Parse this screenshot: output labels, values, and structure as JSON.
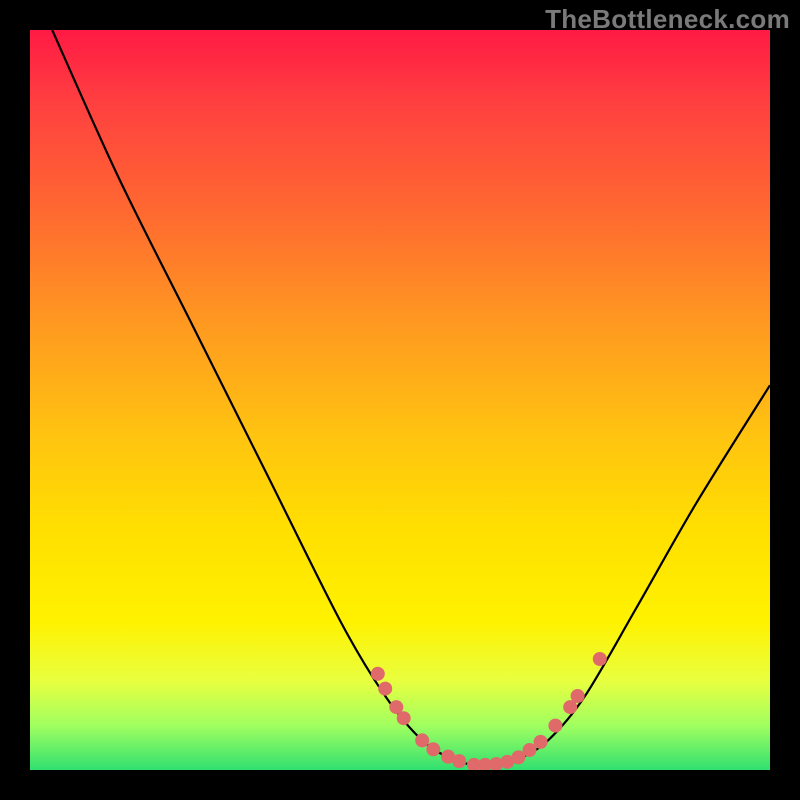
{
  "watermark": "TheBottleneck.com",
  "chart_data": {
    "type": "line",
    "title": "",
    "xlabel": "",
    "ylabel": "",
    "xlim": [
      0,
      100
    ],
    "ylim": [
      0,
      100
    ],
    "curve": [
      {
        "x": 3,
        "y": 100
      },
      {
        "x": 12,
        "y": 80
      },
      {
        "x": 22,
        "y": 60
      },
      {
        "x": 32,
        "y": 40
      },
      {
        "x": 42,
        "y": 20
      },
      {
        "x": 48,
        "y": 10
      },
      {
        "x": 53,
        "y": 4
      },
      {
        "x": 57,
        "y": 1.5
      },
      {
        "x": 60,
        "y": 0.7
      },
      {
        "x": 63,
        "y": 0.7
      },
      {
        "x": 66,
        "y": 1.5
      },
      {
        "x": 70,
        "y": 4
      },
      {
        "x": 75,
        "y": 10
      },
      {
        "x": 82,
        "y": 22
      },
      {
        "x": 90,
        "y": 36
      },
      {
        "x": 100,
        "y": 52
      }
    ],
    "dots": [
      {
        "x": 47,
        "y": 13
      },
      {
        "x": 48,
        "y": 11
      },
      {
        "x": 49.5,
        "y": 8.5
      },
      {
        "x": 50.5,
        "y": 7
      },
      {
        "x": 53,
        "y": 4
      },
      {
        "x": 54.5,
        "y": 2.8
      },
      {
        "x": 56.5,
        "y": 1.8
      },
      {
        "x": 58,
        "y": 1.2
      },
      {
        "x": 60,
        "y": 0.7
      },
      {
        "x": 61.5,
        "y": 0.7
      },
      {
        "x": 63,
        "y": 0.8
      },
      {
        "x": 64.5,
        "y": 1.1
      },
      {
        "x": 66,
        "y": 1.7
      },
      {
        "x": 67.5,
        "y": 2.7
      },
      {
        "x": 69,
        "y": 3.8
      },
      {
        "x": 71,
        "y": 6
      },
      {
        "x": 73,
        "y": 8.5
      },
      {
        "x": 74,
        "y": 10
      },
      {
        "x": 77,
        "y": 15
      }
    ],
    "legend": [],
    "grid": false
  }
}
